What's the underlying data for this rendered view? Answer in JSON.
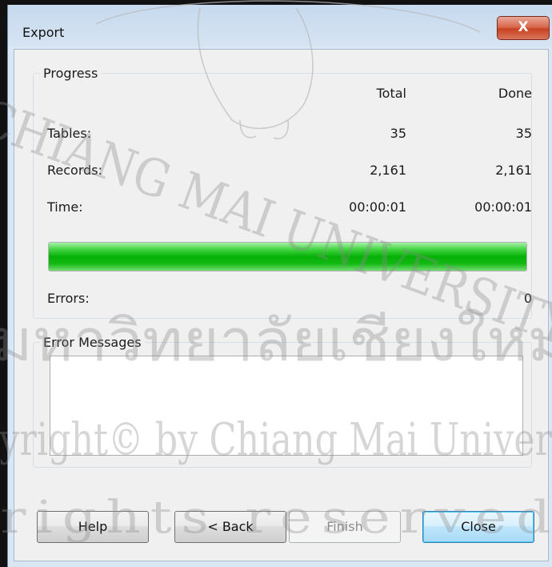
{
  "window": {
    "title": "Export",
    "close_glyph": "X"
  },
  "progress": {
    "legend": "Progress",
    "headers": {
      "total": "Total",
      "done": "Done"
    },
    "rows": [
      {
        "label": "Tables:",
        "total": "35",
        "done": "35"
      },
      {
        "label": "Records:",
        "total": "2,161",
        "done": "2,161"
      },
      {
        "label": "Time:",
        "total": "00:00:01",
        "done": "00:00:01"
      }
    ],
    "bar_fraction": 1.0,
    "bar_color": "#06b006",
    "errors_label": "Errors:",
    "errors_value": "0"
  },
  "error_messages": {
    "legend": "Error Messages",
    "content": ""
  },
  "buttons": {
    "help": "Help",
    "back": "< Back",
    "finish": "Finish",
    "close": "Close"
  },
  "watermark": {
    "line1": "CHIANG MAI UNIVERSITY",
    "line2": "มหาวิทยาลัยเชียงใหม่",
    "line3": "Copyright© by Chiang Mai University",
    "line4": "All rights reserved"
  }
}
